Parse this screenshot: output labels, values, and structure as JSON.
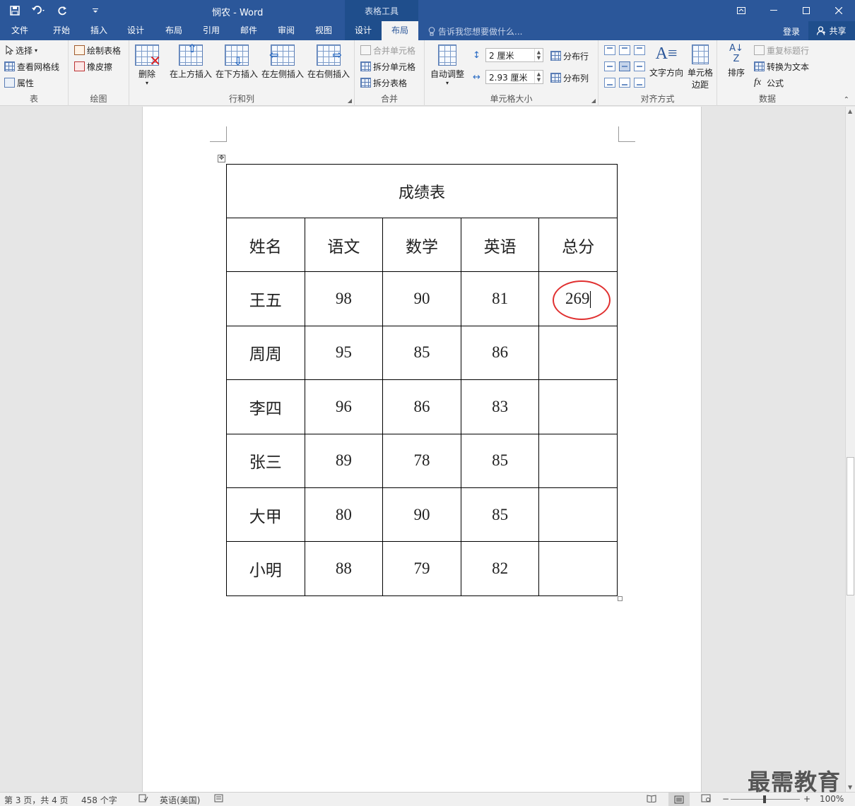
{
  "app": {
    "title": "悯农 - Word",
    "context_tab_header": "表格工具",
    "login": "登录",
    "share": "共享",
    "tell_me": "告诉我您想要做什么..."
  },
  "tabs": [
    {
      "label": "文件"
    },
    {
      "label": "开始"
    },
    {
      "label": "插入"
    },
    {
      "label": "设计"
    },
    {
      "label": "布局"
    },
    {
      "label": "引用"
    },
    {
      "label": "邮件"
    },
    {
      "label": "审阅"
    },
    {
      "label": "视图"
    },
    {
      "label": "设计"
    },
    {
      "label": "布局"
    }
  ],
  "ribbon": {
    "table": {
      "label": "表",
      "select": "选择",
      "gridlines": "查看网格线",
      "properties": "属性"
    },
    "draw": {
      "label": "绘图",
      "draw_table": "绘制表格",
      "eraser": "橡皮擦"
    },
    "rows_cols": {
      "label": "行和列",
      "delete": "删除",
      "insert_above": "在上方插入",
      "insert_below": "在下方插入",
      "insert_left": "在左侧插入",
      "insert_right": "在右侧插入"
    },
    "merge": {
      "label": "合并",
      "merge_cells": "合并单元格",
      "split_cells": "拆分单元格",
      "split_table": "拆分表格"
    },
    "cell_size": {
      "label": "单元格大小",
      "autofit": "自动调整",
      "height": "2 厘米",
      "width": "2.93 厘米",
      "distribute_rows": "分布行",
      "distribute_cols": "分布列"
    },
    "alignment": {
      "label": "对齐方式",
      "text_direction": "文字方向",
      "cell_margins_1": "单元格",
      "cell_margins_2": "边距"
    },
    "data": {
      "label": "数据",
      "sort": "排序",
      "repeat_header": "重复标题行",
      "convert_text": "转换为文本",
      "formula": "公式",
      "fx": "fx"
    }
  },
  "document": {
    "table_title": "成绩表",
    "headers": [
      "姓名",
      "语文",
      "数学",
      "英语",
      "总分"
    ],
    "rows": [
      {
        "name": "王五",
        "chinese": "98",
        "math": "90",
        "english": "81",
        "total": "269"
      },
      {
        "name": "周周",
        "chinese": "95",
        "math": "85",
        "english": "86",
        "total": ""
      },
      {
        "name": "李四",
        "chinese": "96",
        "math": "86",
        "english": "83",
        "total": ""
      },
      {
        "name": "张三",
        "chinese": "89",
        "math": "78",
        "english": "85",
        "total": ""
      },
      {
        "name": "大甲",
        "chinese": "80",
        "math": "90",
        "english": "85",
        "total": ""
      },
      {
        "name": "小明",
        "chinese": "88",
        "math": "79",
        "english": "82",
        "total": ""
      }
    ]
  },
  "status": {
    "page": "第 3 页，共 4 页",
    "words": "458 个字",
    "language": "英语(美国)",
    "zoom": "100%"
  },
  "watermark": "最需教育",
  "colors": {
    "ribbon_blue": "#2b579a",
    "context_blue": "#1f4e8c",
    "annotation_red": "#e03030"
  }
}
